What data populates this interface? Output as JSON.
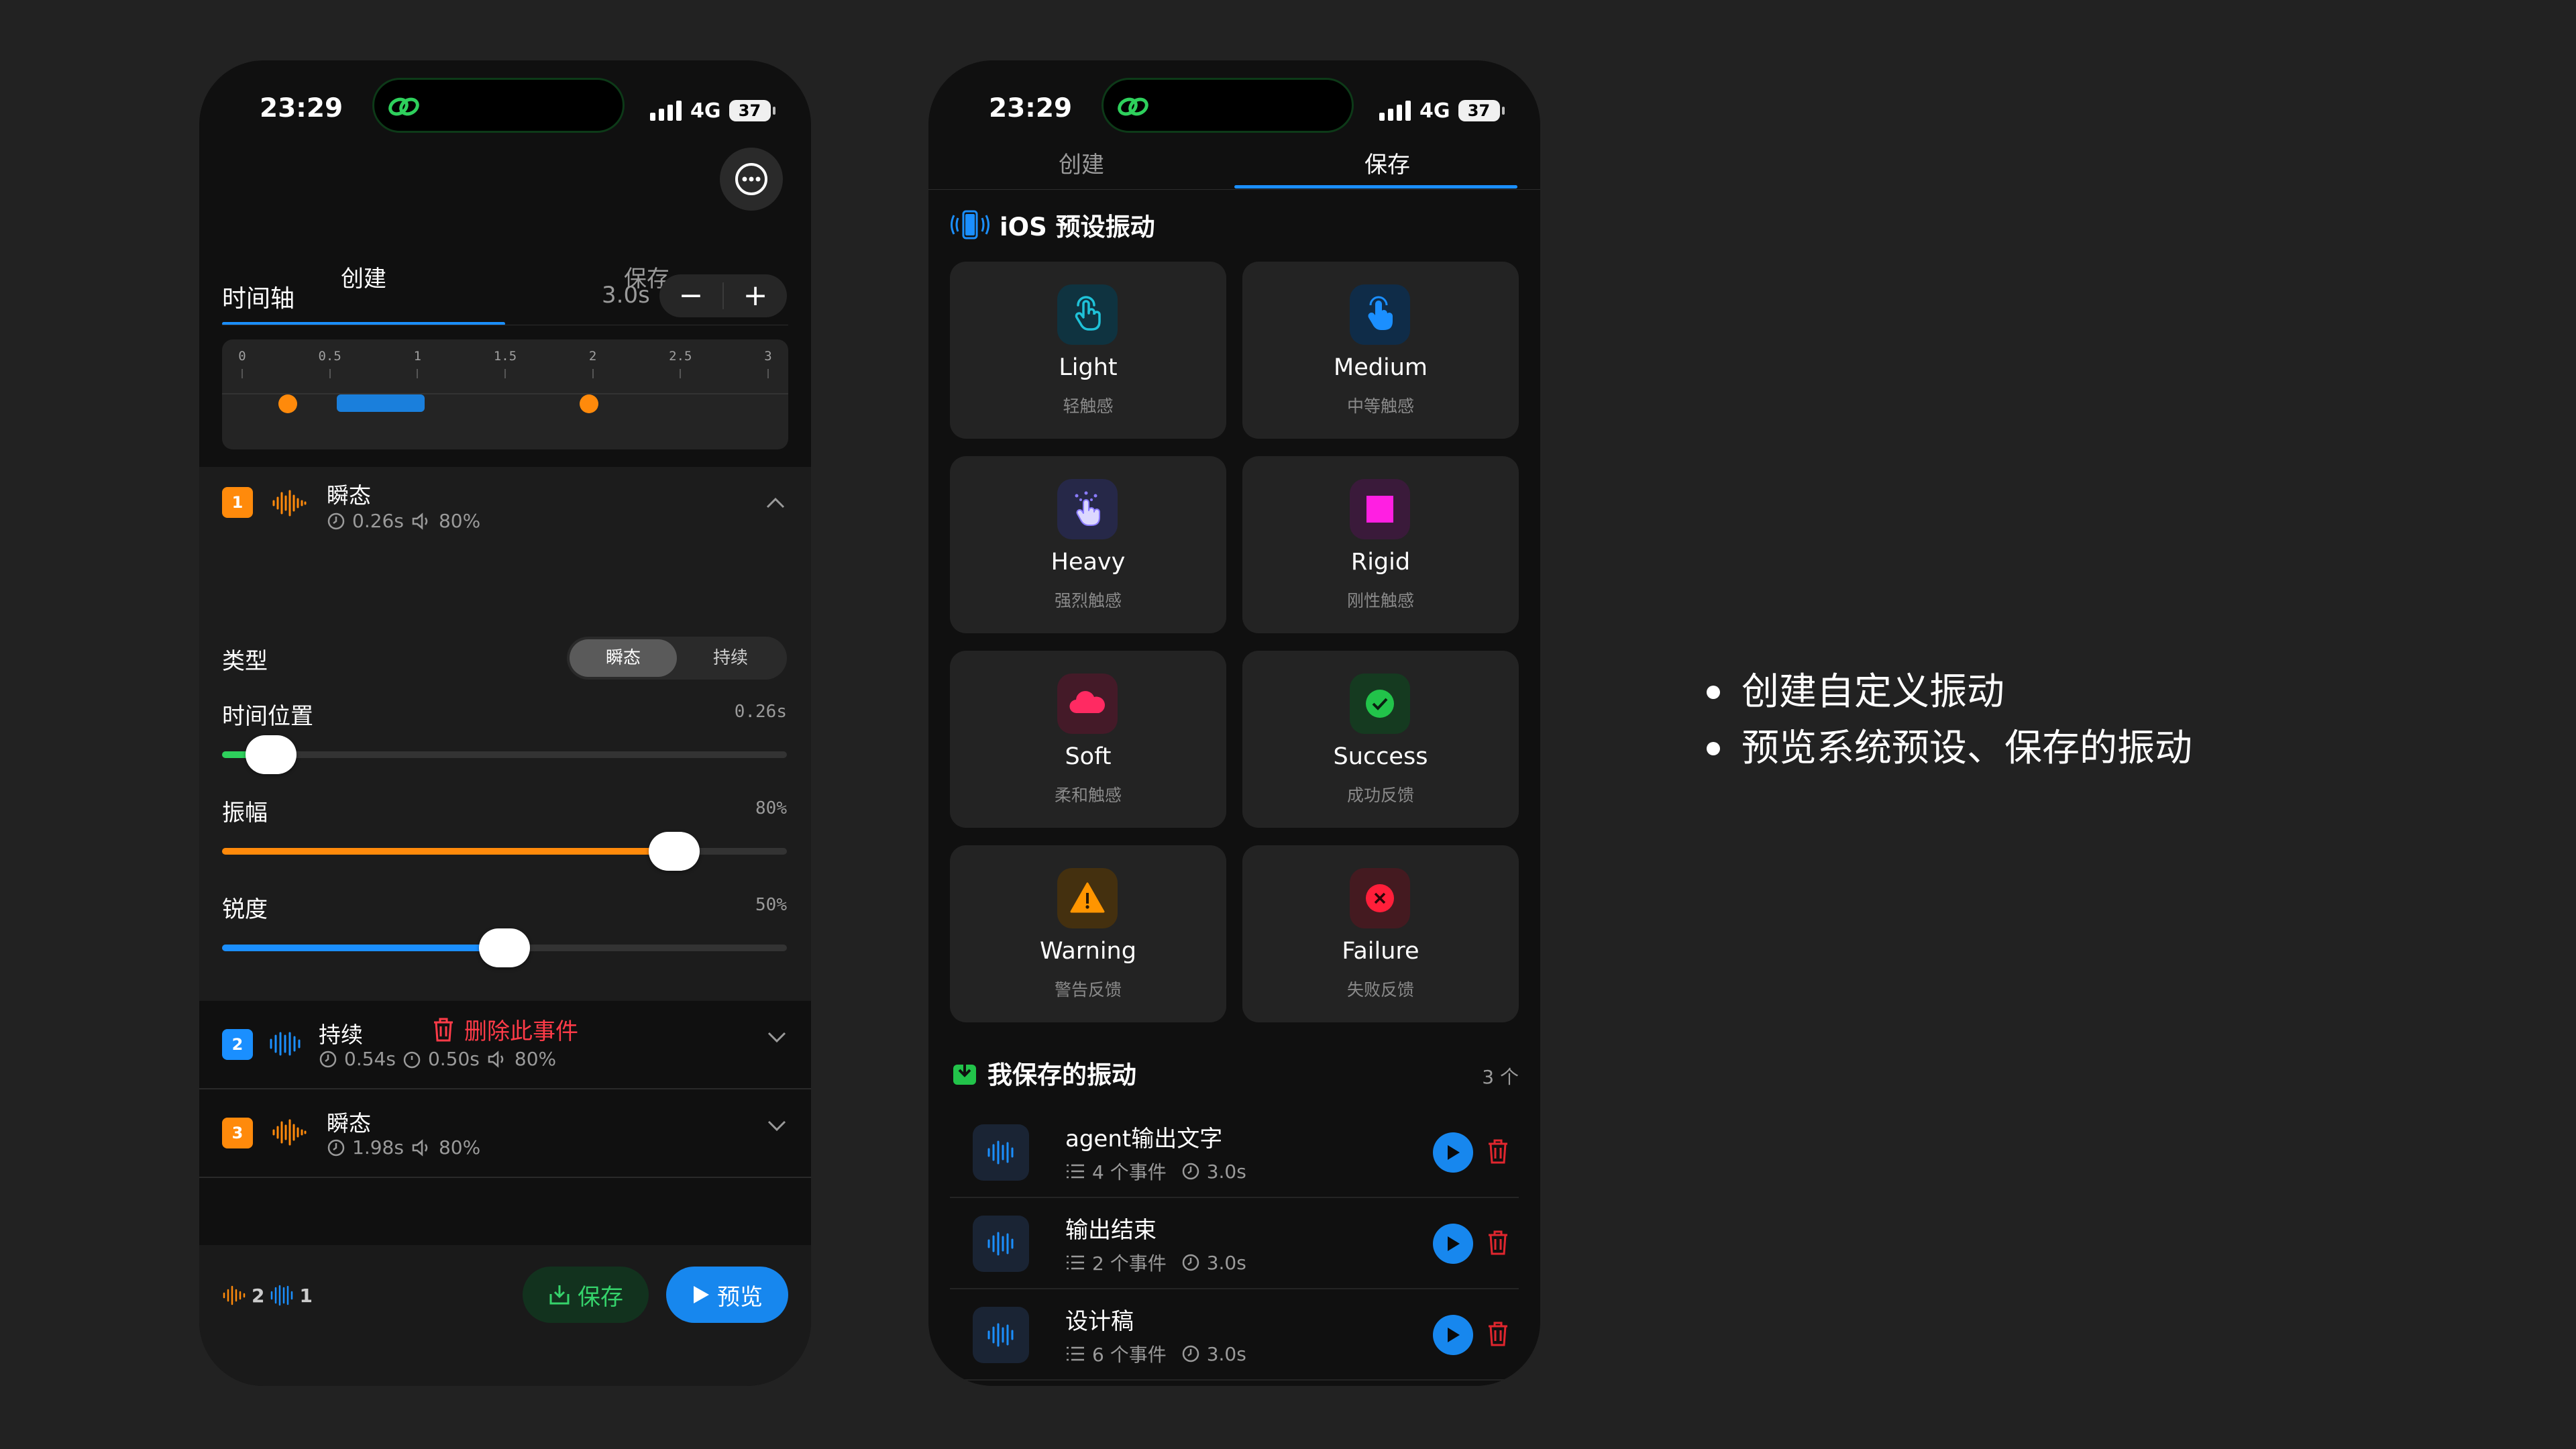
{
  "status": {
    "time": "23:29",
    "network": "4G",
    "battery": "37"
  },
  "tabs": {
    "create": "创建",
    "save": "保存"
  },
  "editor": {
    "timeline_label": "时间轴",
    "duration": "3.0s",
    "minus": "−",
    "plus": "+",
    "ticks": [
      "0",
      "0.5",
      "1",
      "1.5",
      "2",
      "2.5",
      "3"
    ],
    "events_preview": [
      {
        "kind": "transient",
        "time": 0.26
      },
      {
        "kind": "continuous",
        "time": 0.54,
        "duration": 0.5
      },
      {
        "kind": "transient",
        "time": 1.98
      }
    ],
    "expanded_event": {
      "index": "1",
      "title": "瞬态",
      "time": "0.26s",
      "intensity": "80%",
      "type_label": "类型",
      "type_options": [
        "瞬态",
        "持续"
      ],
      "type_selected": "瞬态",
      "position_label": "时间位置",
      "position_value": "0.26s",
      "position_fraction": 0.087,
      "amplitude_label": "振幅",
      "amplitude_value": "80%",
      "amplitude_fraction": 0.8,
      "sharpness_label": "锐度",
      "sharpness_value": "50%",
      "sharpness_fraction": 0.5,
      "delete_label": "删除此事件"
    },
    "events": [
      {
        "index": "2",
        "title": "持续",
        "time": "0.54s",
        "duration": "0.50s",
        "intensity": "80%",
        "color": "#1a8fff"
      },
      {
        "index": "3",
        "title": "瞬态",
        "time": "1.98s",
        "intensity": "80%",
        "color": "#ff8a0b"
      }
    ],
    "footer": {
      "transient_count": "2",
      "continuous_count": "1",
      "save_label": "保存",
      "preview_label": "预览"
    }
  },
  "presets": {
    "section_title": "iOS 预设振动",
    "items": [
      {
        "name": "Light",
        "sub": "轻触感",
        "icon": "hand-tap-icon",
        "color": "#1fc2d8",
        "bg": "#0f3340"
      },
      {
        "name": "Medium",
        "sub": "中等触感",
        "icon": "hand-tap-icon",
        "color": "#1b8fff",
        "bg": "#0f2c48"
      },
      {
        "name": "Heavy",
        "sub": "强烈触感",
        "icon": "hand-tap-icon",
        "color": "#8a7bff",
        "bg": "#262848"
      },
      {
        "name": "Rigid",
        "sub": "刚性触感",
        "icon": "square-icon",
        "color": "#ff1fe2",
        "bg": "#3a1a3a"
      },
      {
        "name": "Soft",
        "sub": "柔和触感",
        "icon": "cloud-icon",
        "color": "#ff2a62",
        "bg": "#441a28"
      },
      {
        "name": "Success",
        "sub": "成功反馈",
        "icon": "check-circle-icon",
        "color": "#22c34a",
        "bg": "#153a20"
      },
      {
        "name": "Warning",
        "sub": "警告反馈",
        "icon": "warning-triangle-icon",
        "color": "#ff9500",
        "bg": "#44300f"
      },
      {
        "name": "Failure",
        "sub": "失败反馈",
        "icon": "x-circle-icon",
        "color": "#ff1f3a",
        "bg": "#441a20"
      }
    ]
  },
  "saved": {
    "section_title": "我保存的振动",
    "count": "3 个",
    "items": [
      {
        "name": "agent输出文字",
        "events": "4 个事件",
        "duration": "3.0s"
      },
      {
        "name": "输出结束",
        "events": "2 个事件",
        "duration": "3.0s"
      },
      {
        "name": "设计稿",
        "events": "6 个事件",
        "duration": "3.0s"
      }
    ]
  },
  "bullets": [
    "创建自定义振动",
    "预览系统预设、保存的振动"
  ]
}
